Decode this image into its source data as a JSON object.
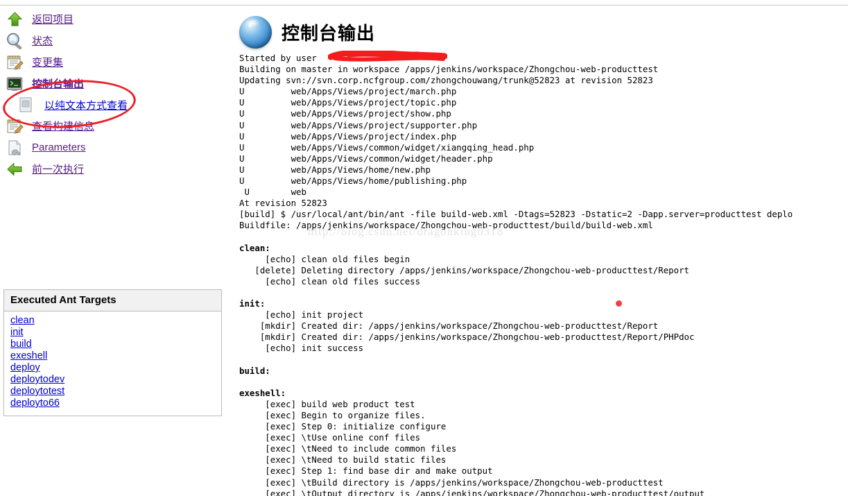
{
  "page": {
    "title": "控制台输出",
    "title_icon": "blue-globe-icon",
    "watermark": "http://blog.csdn.net/dragonking0318"
  },
  "sidebar": {
    "items": [
      {
        "label": "返回项目",
        "icon": "green-up-arrow-icon",
        "state": "visited",
        "sub": false
      },
      {
        "label": "状态",
        "icon": "magnifier-icon",
        "state": "visited",
        "sub": false
      },
      {
        "label": "变更集",
        "icon": "notepad-pencil-icon",
        "state": "visited",
        "sub": false
      },
      {
        "label": "控制台输出",
        "icon": "terminal-icon",
        "state": "current",
        "sub": false
      },
      {
        "label": "以纯文本方式查看",
        "icon": "plain-document-icon",
        "state": "link",
        "sub": true
      },
      {
        "label": "查看构建信息",
        "icon": "notepad-pencil-icon",
        "state": "visited",
        "sub": false
      },
      {
        "label": "Parameters",
        "icon": "document-wrench-icon",
        "state": "visited",
        "sub": false
      },
      {
        "label": "前一次执行",
        "icon": "green-left-arrow-icon",
        "state": "visited",
        "sub": false
      }
    ]
  },
  "ant_panel": {
    "header": "Executed Ant Targets",
    "targets": [
      "clean",
      "init",
      "build",
      "exeshell",
      "deploy",
      "deploytodev",
      "deploytotest",
      "deployto66"
    ]
  },
  "console": {
    "lines": [
      {
        "text": "Started by user ",
        "bold": false,
        "redacted": true
      },
      {
        "text": "Building on master in workspace /apps/jenkins/workspace/Zhongchou-web-producttest",
        "bold": false
      },
      {
        "text": "Updating svn://svn.corp.ncfgroup.com/zhongchouwang/trunk@52823 at revision 52823",
        "bold": false
      },
      {
        "text": "U         web/Apps/Views/project/march.php",
        "bold": false
      },
      {
        "text": "U         web/Apps/Views/project/topic.php",
        "bold": false
      },
      {
        "text": "U         web/Apps/Views/project/show.php",
        "bold": false
      },
      {
        "text": "U         web/Apps/Views/project/supporter.php",
        "bold": false
      },
      {
        "text": "U         web/Apps/Views/project/index.php",
        "bold": false
      },
      {
        "text": "U         web/Apps/Views/common/widget/xiangqing_head.php",
        "bold": false
      },
      {
        "text": "U         web/Apps/Views/common/widget/header.php",
        "bold": false
      },
      {
        "text": "U         web/Apps/Views/home/new.php",
        "bold": false
      },
      {
        "text": "U         web/Apps/Views/home/publishing.php",
        "bold": false
      },
      {
        "text": " U        web",
        "bold": false
      },
      {
        "text": "At revision 52823",
        "bold": false
      },
      {
        "text": "[build] $ /usr/local/ant/bin/ant -file build-web.xml -Dtags=52823 -Dstatic=2 -Dapp.server=producttest deplo",
        "bold": false
      },
      {
        "text": "Buildfile: /apps/jenkins/workspace/Zhongchou-web-producttest/build/build-web.xml",
        "bold": false
      },
      {
        "text": "",
        "bold": false
      },
      {
        "text": "clean:",
        "bold": true
      },
      {
        "text": "     [echo] clean old files begin",
        "bold": false
      },
      {
        "text": "   [delete] Deleting directory /apps/jenkins/workspace/Zhongchou-web-producttest/Report",
        "bold": false
      },
      {
        "text": "     [echo] clean old files success",
        "bold": false
      },
      {
        "text": "",
        "bold": false
      },
      {
        "text": "init:",
        "bold": true
      },
      {
        "text": "     [echo] init project",
        "bold": false
      },
      {
        "text": "    [mkdir] Created dir: /apps/jenkins/workspace/Zhongchou-web-producttest/Report",
        "bold": false
      },
      {
        "text": "    [mkdir] Created dir: /apps/jenkins/workspace/Zhongchou-web-producttest/Report/PHPdoc",
        "bold": false
      },
      {
        "text": "     [echo] init success",
        "bold": false
      },
      {
        "text": "",
        "bold": false
      },
      {
        "text": "build:",
        "bold": true
      },
      {
        "text": "",
        "bold": false
      },
      {
        "text": "exeshell:",
        "bold": true
      },
      {
        "text": "     [exec] build web product test",
        "bold": false
      },
      {
        "text": "     [exec] Begin to organize files.",
        "bold": false
      },
      {
        "text": "     [exec] Step 0: initialize configure",
        "bold": false
      },
      {
        "text": "     [exec] \\tUse online conf files",
        "bold": false
      },
      {
        "text": "     [exec] \\tNeed to include common files",
        "bold": false
      },
      {
        "text": "     [exec] \\tNeed to build static files",
        "bold": false
      },
      {
        "text": "     [exec] Step 1: find base dir and make output",
        "bold": false
      },
      {
        "text": "     [exec] \\tBuild directory is /apps/jenkins/workspace/Zhongchou-web-producttest",
        "bold": false
      },
      {
        "text": "     [exec] \\tOutput directory is /apps/jenkins/workspace/Zhongchou-web-producttest/output",
        "bold": false
      }
    ]
  },
  "annotations": {
    "ellipse_color": "#ec1c24",
    "dot_color": "#f24040",
    "redaction_color": "#f41c1c"
  }
}
